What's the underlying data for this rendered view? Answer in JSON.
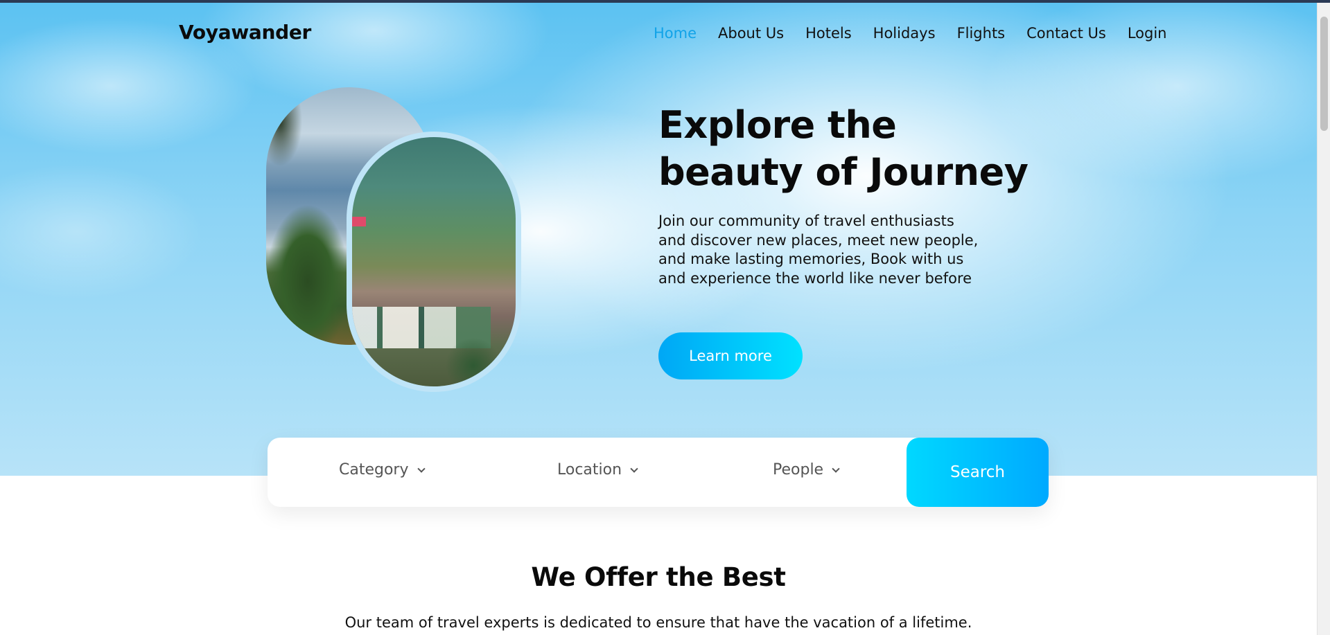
{
  "brand": {
    "name": "Voyawander"
  },
  "nav": {
    "items": [
      {
        "label": "Home",
        "active": true
      },
      {
        "label": "About Us",
        "active": false
      },
      {
        "label": "Hotels",
        "active": false
      },
      {
        "label": "Holidays",
        "active": false
      },
      {
        "label": "Flights",
        "active": false
      },
      {
        "label": "Contact Us",
        "active": false
      },
      {
        "label": "Login",
        "active": false
      }
    ]
  },
  "hero": {
    "title_line1": "Explore the",
    "title_line2": "beauty of Journey",
    "description": "Join our community of travel enthusiasts and discover new places, meet new people, and make lasting memories, Book with us and experience the world like never before",
    "cta_label": "Learn more"
  },
  "search": {
    "category": "Category",
    "location": "Location",
    "people": "People",
    "button_label": "Search"
  },
  "offer": {
    "title": "We Offer the Best",
    "text": "Our team of travel experts is dedicated to ensure that have the vacation of a lifetime."
  },
  "colors": {
    "accent": "#11a3e8",
    "button_gradient_start": "#00a7f5",
    "button_gradient_end": "#00e1ff"
  }
}
